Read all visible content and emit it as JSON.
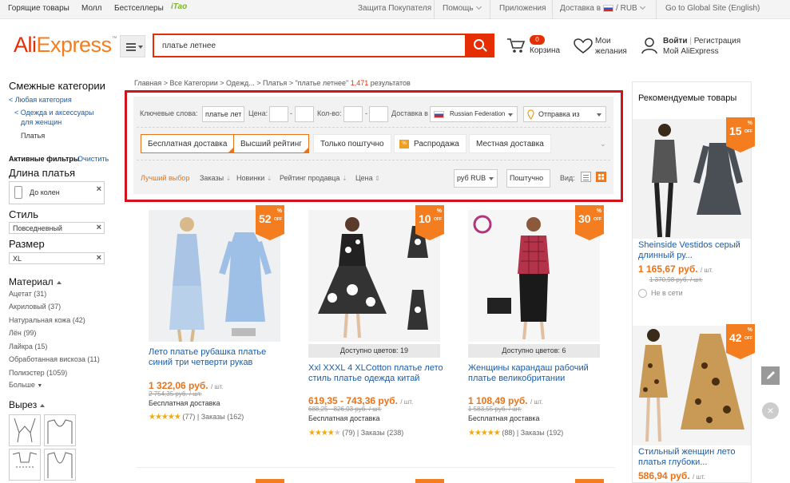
{
  "topbar": {
    "left_links": [
      "Горящие товары",
      "Молл",
      "Бестселлеры"
    ],
    "itao": "iTao",
    "buyer_protection": "Защита Покупателя",
    "help": "Помощь",
    "apps": "Приложения",
    "shipping_to": "Доставка в",
    "currency": "RUB",
    "global_site": "Go to Global Site (English)"
  },
  "header": {
    "logo_a": "Ali",
    "logo_b": "Express",
    "logo_tm": "™",
    "search_value": "платье летнее",
    "cart_count": "0",
    "cart_label": "Корзина",
    "wishlist_line1": "Мои",
    "wishlist_line2": "желания",
    "signin": "Войти",
    "register": "Регистрация",
    "my_account": "Мой AliExpress"
  },
  "sidebar": {
    "related_title": "Смежные категории",
    "any_category": "< Любая категория",
    "cat_line1": "< Одежда и аксессуары",
    "cat_line2": "для женщин",
    "cat_current": "Платья",
    "active_filters": "Активные фильтры",
    "clear": "Очистить",
    "length_title": "Длина платья",
    "length_value": "До колен",
    "style_title": "Стиль",
    "style_value": "Повседневный",
    "size_title": "Размер",
    "size_value": "XL",
    "material_title": "Материал",
    "materials": [
      "Ацетат (31)",
      "Акриловый (37)",
      "Натуральная кожа (42)",
      "Лён (99)",
      "Лайкра (15)",
      "Обработанная вискоза (11)",
      "Полиэстер (1059)"
    ],
    "more": "Больше",
    "neckline_title": "Вырез"
  },
  "breadcrumb": {
    "path": "Главная > Все Категории > Одежд... > Платья > \"платье летнее\"",
    "count": "1,471",
    "suffix": "результатов"
  },
  "filters": {
    "keywords_label": "Ключевые слова:",
    "keywords_value": "платье лет",
    "price_label": "Цена:",
    "qty_label": "Кол-во:",
    "dash": "-",
    "ship_to_label": "Доставка в",
    "ship_to_value": "Russian Federation",
    "ship_from": "Отправка из",
    "btn_free": "Бесплатная доставка",
    "btn_top": "Высший рейтинг",
    "btn_single": "Только поштучно",
    "btn_sale": "Распродажа",
    "btn_local": "Местная доставка",
    "sort_best": "Лучший выбор",
    "sort_orders": "Заказы",
    "sort_new": "Новинки",
    "sort_seller": "Рейтинг продавца",
    "sort_price": "Цена",
    "currency_sel": "руб RUB",
    "per_piece": "Поштучно",
    "view_label": "Вид:"
  },
  "products": [
    {
      "discount": "52",
      "title": "Лето платье рубашка платье синий три четверти рукав",
      "price": "1 322,06 руб.",
      "unit": "/ шт.",
      "old_price": "2 754,35 руб. / шт.",
      "shipping": "Бесплатная доставка",
      "rating": "(77)",
      "orders": "Заказы (162)",
      "colors": ""
    },
    {
      "discount": "10",
      "title": "Xxl XXXL 4 XLCotton платье лето стиль платье одежда китай",
      "price": "619,35 - 743,36 руб.",
      "unit": "/ шт.",
      "old_price": "688,25 - 826,03 руб. / шт.",
      "shipping": "Бесплатная доставка",
      "rating": "(79)",
      "orders": "Заказы (238)",
      "colors": "Доступно цветов: 19"
    },
    {
      "discount": "30",
      "title": "Женщины карандаш рабочий платье великобритании",
      "price": "1 108,49 руб.",
      "unit": "/ шт.",
      "old_price": "1 583,55 руб. / шт.",
      "shipping": "Бесплатная доставка",
      "rating": "(88)",
      "orders": "Заказы (192)",
      "colors": "Доступно цветов: 6"
    }
  ],
  "recommended": {
    "title": "Рекомендуемые товары",
    "items": [
      {
        "discount": "15",
        "title": "Sheinside Vestidos серый длинный ру...",
        "price": "1 165,67 руб.",
        "unit": "/ шт.",
        "old_price": "1 370,98 руб. / шт.",
        "status": "Не в сети"
      },
      {
        "discount": "42",
        "title": "Стильный женщин лето платья глубоки...",
        "price": "586,94 руб.",
        "unit": "/ шт."
      }
    ]
  },
  "misc": {
    "percent": "%",
    "off": "OFF",
    "close": "×"
  },
  "colors": {
    "accent": "#e62e04",
    "orange": "#f47d20",
    "link": "#1a5ca8",
    "highlight_box": "#d0141a"
  }
}
